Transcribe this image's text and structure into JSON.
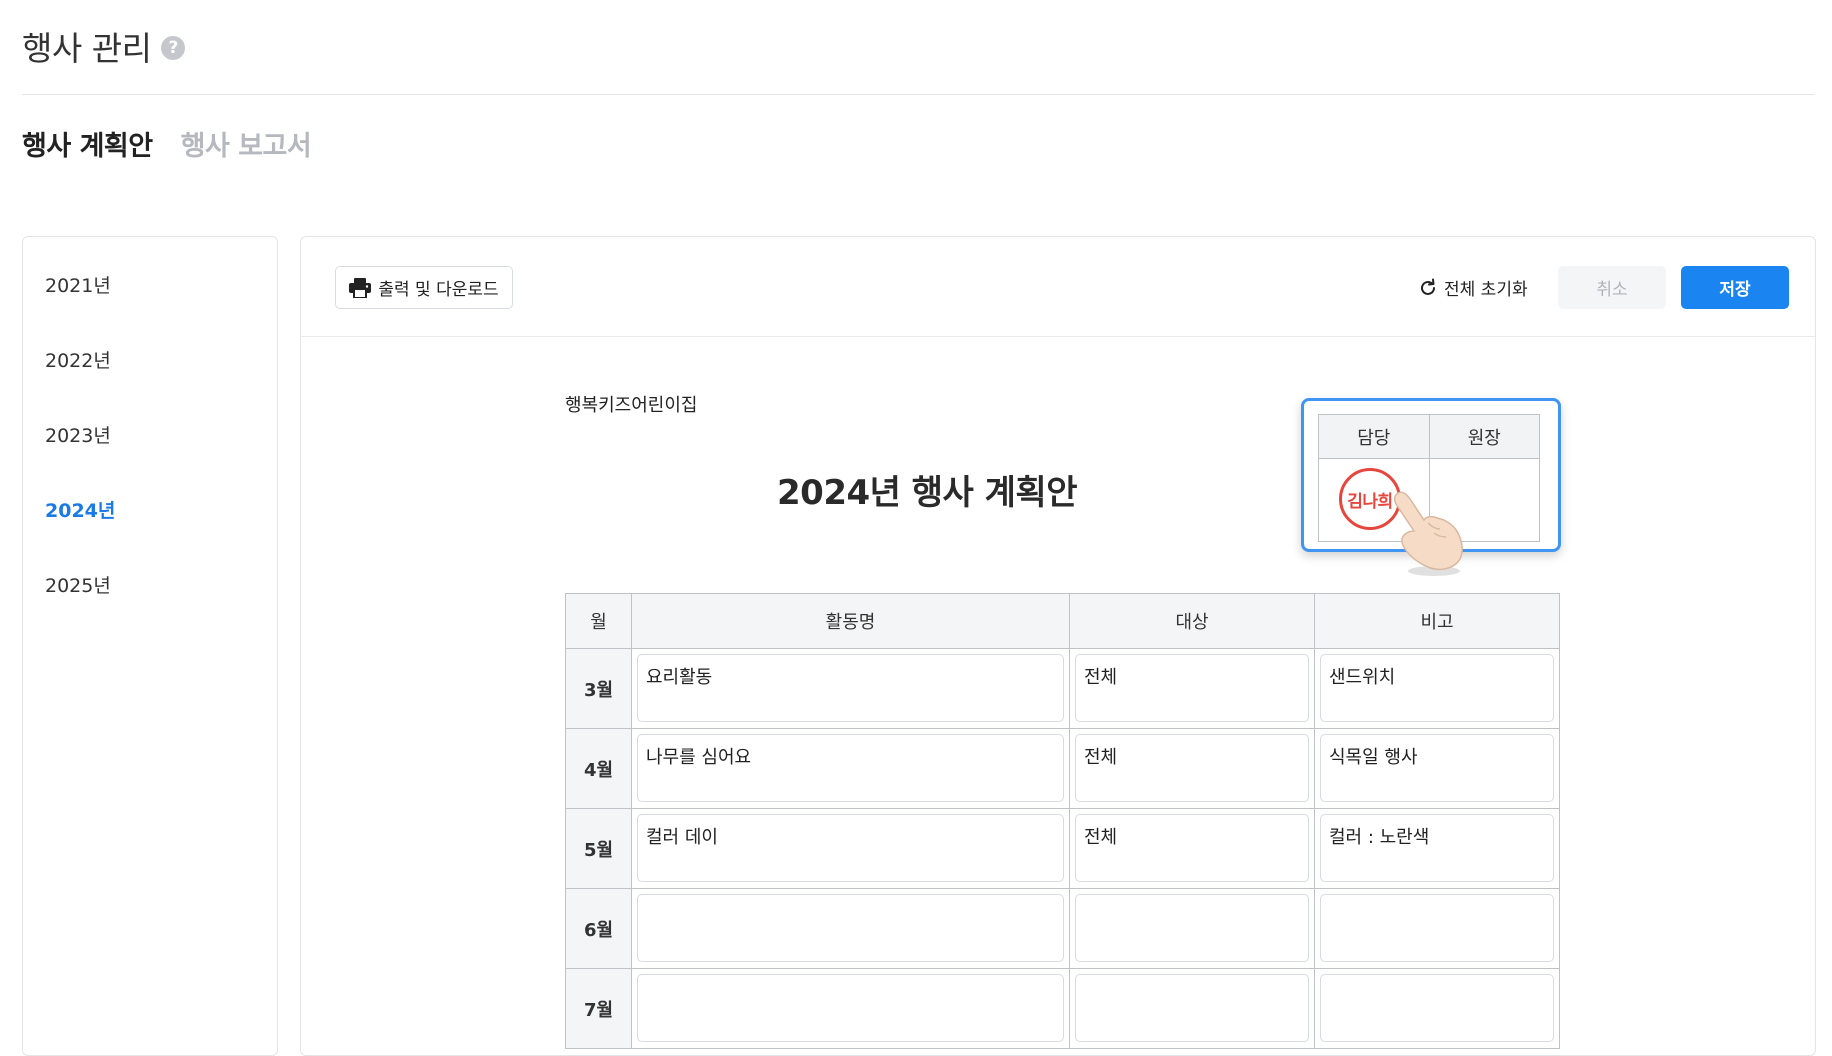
{
  "header": {
    "title": "행사 관리",
    "help_icon": "question-circle-icon"
  },
  "tabs": [
    {
      "label": "행사 계획안",
      "active": true
    },
    {
      "label": "행사 보고서",
      "active": false
    }
  ],
  "years": [
    {
      "label": "2021년",
      "selected": false
    },
    {
      "label": "2022년",
      "selected": false
    },
    {
      "label": "2023년",
      "selected": false
    },
    {
      "label": "2024년",
      "selected": true
    },
    {
      "label": "2025년",
      "selected": false
    }
  ],
  "toolbar": {
    "print_label": "출력 및 다운로드",
    "reset_label": "전체 초기화",
    "cancel_label": "취소",
    "save_label": "저장",
    "save_color": "#1a84f0"
  },
  "document": {
    "org_name": "행복키즈어린이집",
    "title": "2024년 행사 계획안",
    "approval": {
      "headers": [
        "담당",
        "원장"
      ],
      "stamp_text": "김나희",
      "stamp_color": "#e8453c"
    },
    "table": {
      "headers": [
        "월",
        "활동명",
        "대상",
        "비고"
      ],
      "rows": [
        {
          "month": "3월",
          "activity": "요리활동",
          "target": "전체",
          "note": "샌드위치"
        },
        {
          "month": "4월",
          "activity": "나무를 심어요",
          "target": "전체",
          "note": "식목일 행사"
        },
        {
          "month": "5월",
          "activity": "컬러 데이",
          "target": "전체",
          "note": "컬러 : 노란색"
        },
        {
          "month": "6월",
          "activity": "",
          "target": "",
          "note": ""
        },
        {
          "month": "7월",
          "activity": "",
          "target": "",
          "note": ""
        }
      ]
    }
  }
}
